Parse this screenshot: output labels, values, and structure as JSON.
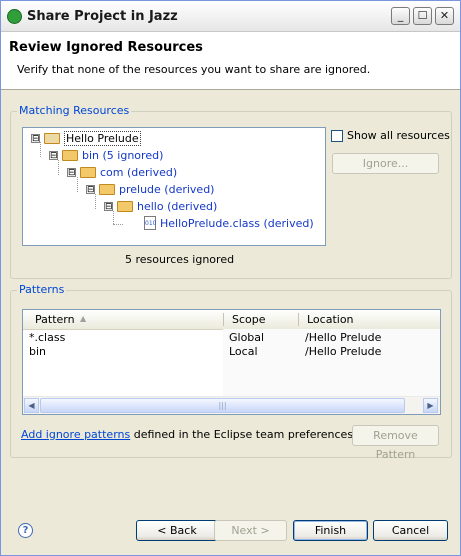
{
  "window": {
    "title": "Share Project in Jazz",
    "controls": {
      "minimize": "_",
      "maximize": "☐",
      "close": "✕"
    }
  },
  "header": {
    "title": "Review Ignored Resources",
    "description": "Verify that none of the resources you want to share are ignored."
  },
  "matching": {
    "legend": "Matching Resources",
    "tree": [
      {
        "label": "Hello Prelude",
        "expander": "⊟",
        "icon": "project-folder-icon"
      },
      {
        "label": "bin (5 ignored)",
        "expander": "⊟",
        "icon": "folder-icon"
      },
      {
        "label": "com (derived)",
        "expander": "⊟",
        "icon": "folder-icon"
      },
      {
        "label": "prelude (derived)",
        "expander": "⊟",
        "icon": "folder-icon"
      },
      {
        "label": "hello (derived)",
        "expander": "⊟",
        "icon": "folder-icon"
      },
      {
        "label": "HelloPrelude.class (derived)",
        "icon": "class-file-icon",
        "icon_text": "010"
      }
    ],
    "show_all_label": "Show all resources",
    "ignore_button": "Ignore...",
    "summary": "5 resources ignored"
  },
  "patterns": {
    "legend": "Patterns",
    "columns": [
      "Pattern",
      "Scope",
      "Location"
    ],
    "sort_indicator": "▲",
    "rows": [
      {
        "pattern": "*.class",
        "scope": "Global",
        "location": "/Hello Prelude"
      },
      {
        "pattern": "bin",
        "scope": "Local",
        "location": "/Hello Prelude"
      }
    ],
    "scroll": {
      "left": "◀",
      "right": "▶",
      "grip": "|||"
    },
    "add_link": "Add ignore patterns",
    "add_link_suffix": " defined in the Eclipse team preferences.",
    "remove_button": "Remove Pattern"
  },
  "footer": {
    "help": "?",
    "back": "< Back",
    "next": "Next >",
    "finish": "Finish",
    "cancel": "Cancel"
  }
}
